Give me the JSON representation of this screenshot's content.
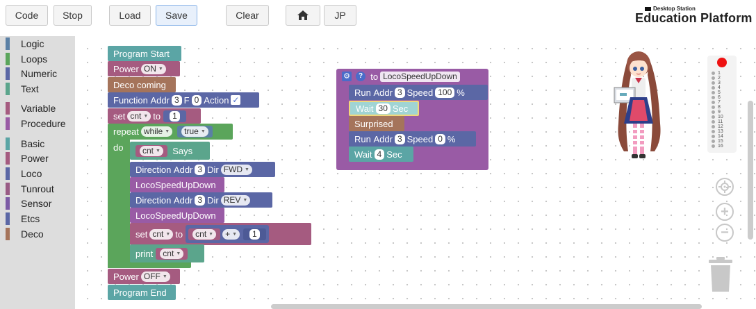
{
  "toolbar": {
    "code": "Code",
    "stop": "Stop",
    "load": "Load",
    "save": "Save",
    "clear": "Clear",
    "home_icon": "home-icon",
    "jp": "JP"
  },
  "logo": {
    "small": "Desktop Station",
    "big": "Education Platform"
  },
  "toolbox": {
    "categories": [
      {
        "label": "Logic",
        "color": "#5b80a5"
      },
      {
        "label": "Loops",
        "color": "#5ba55b"
      },
      {
        "label": "Numeric",
        "color": "#5b67a5"
      },
      {
        "label": "Text",
        "color": "#5ba58c"
      },
      {
        "label": "Variable",
        "color": "#a55b80"
      },
      {
        "label": "Procedure",
        "color": "#995ba5"
      },
      {
        "label": "Basic",
        "color": "#5ba5a5"
      },
      {
        "label": "Power",
        "color": "#a55b80"
      },
      {
        "label": "Loco",
        "color": "#5b67a5"
      },
      {
        "label": "Tunrout",
        "color": "#995b85"
      },
      {
        "label": "Sensor",
        "color": "#7c5ba5"
      },
      {
        "label": "Etcs",
        "color": "#5b67a5"
      },
      {
        "label": "Deco",
        "color": "#a5745b"
      }
    ]
  },
  "program": {
    "start": "Program Start",
    "power1": {
      "label": "Power",
      "value": "ON"
    },
    "deco": "Deco coming",
    "function": {
      "label": "Function",
      "addr": "Addr",
      "addr_val": "3",
      "f": "F",
      "f_val": "0",
      "action": "Action",
      "check": "✓"
    },
    "set1": {
      "label": "set",
      "var": "cnt",
      "to": "to",
      "value": "1"
    },
    "repeat": {
      "label": "repeat",
      "mode": "while",
      "cond": "true",
      "do": "do"
    },
    "say": {
      "var": "cnt",
      "label": "Says"
    },
    "dir1": {
      "label": "Direction",
      "addr": "Addr",
      "addr_val": "3",
      "dir": "Dir",
      "dir_val": "FWD"
    },
    "call1": "LocoSpeedUpDown",
    "dir2": {
      "label": "Direction",
      "addr": "Addr",
      "addr_val": "3",
      "dir": "Dir",
      "dir_val": "REV"
    },
    "call2": "LocoSpeedUpDown",
    "set2": {
      "label": "set",
      "var": "cnt",
      "to": "to",
      "lhs": "cnt",
      "op": "+",
      "rhs": "1"
    },
    "print": {
      "label": "print",
      "var": "cnt"
    },
    "power2": {
      "label": "Power",
      "value": "OFF"
    },
    "end": "Program End"
  },
  "procedure": {
    "to": "to",
    "name": "LocoSpeedUpDown",
    "run1": {
      "label": "Run",
      "addr": "Addr",
      "addr_val": "3",
      "speed": "Speed",
      "speed_val": "100",
      "unit": "%"
    },
    "wait1": {
      "label": "Wait",
      "value": "30",
      "unit": "Sec"
    },
    "surprised": "Surprised",
    "run2": {
      "label": "Run",
      "addr": "Addr",
      "addr_val": "3",
      "speed": "Speed",
      "speed_val": "0",
      "unit": "%"
    },
    "wait2": {
      "label": "Wait",
      "value": "4",
      "unit": "Sec"
    }
  },
  "track_numbers": [
    "1",
    "2",
    "3",
    "4",
    "5",
    "6",
    "7",
    "8",
    "9",
    "10",
    "11",
    "12",
    "13",
    "14",
    "15",
    "16"
  ]
}
